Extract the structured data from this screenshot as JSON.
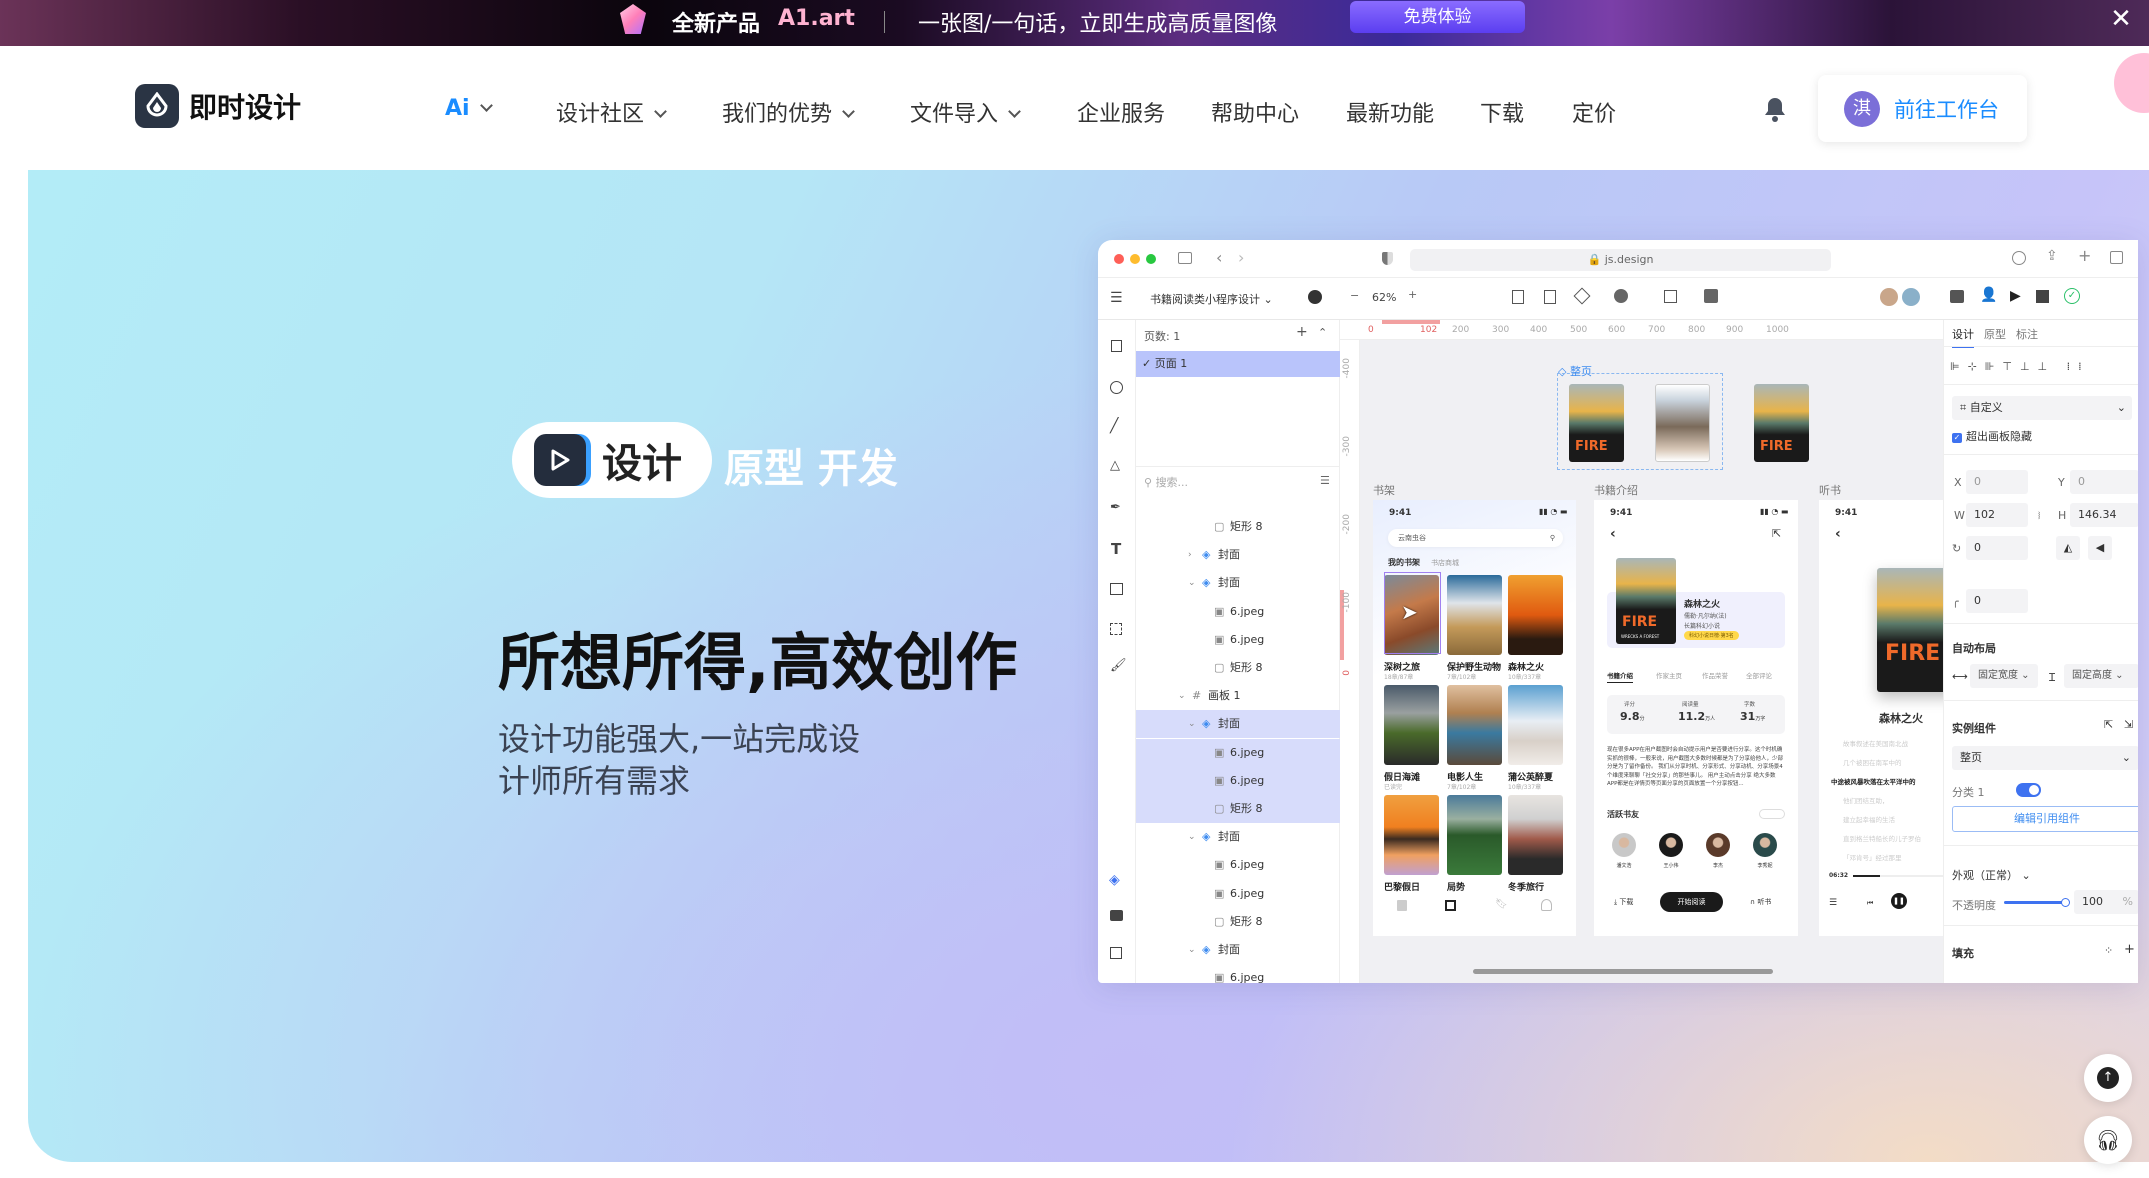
{
  "banner": {
    "product": "全新产品",
    "brand": "A1.art",
    "slogan": "一张图/一句话，立即生成高质量图像",
    "cta": "免费体验",
    "close_icon": "close-icon",
    "brand_color": "#ffb3d1"
  },
  "nav": {
    "logo": "即时设计",
    "items": [
      {
        "label": "Ai",
        "dropdown": true,
        "active": true
      },
      {
        "label": "设计社区",
        "dropdown": true
      },
      {
        "label": "我们的优势",
        "dropdown": true
      },
      {
        "label": "文件导入",
        "dropdown": true
      },
      {
        "label": "企业服务"
      },
      {
        "label": "帮助中心"
      },
      {
        "label": "最新功能"
      },
      {
        "label": "下载"
      },
      {
        "label": "定价"
      }
    ],
    "avatar_initial": "淇",
    "workspace_button": "前往工作台",
    "accent": "#1a8cff"
  },
  "hero": {
    "pill_label": "设计",
    "pill_rest": "原型 开发",
    "headline": "所想所得,高效创作",
    "sub_line1": "设计功能强大,一站完成设",
    "sub_line2": "计师所有需求"
  },
  "mock": {
    "url": "js.design",
    "file_name": "书籍阅读类小程序设计",
    "zoom": "62%",
    "pages_label": "页数: 1",
    "page1": "页面 1",
    "search_placeholder": "搜索...",
    "layers": [
      {
        "name": "矩形 8",
        "level": 2,
        "type": "rect"
      },
      {
        "name": "封面",
        "level": 1,
        "type": "comp",
        "arrow": "right"
      },
      {
        "name": "封面",
        "level": 1,
        "type": "comp",
        "arrow": "down"
      },
      {
        "name": "6.jpeg",
        "level": 2,
        "type": "img"
      },
      {
        "name": "6.jpeg",
        "level": 2,
        "type": "img"
      },
      {
        "name": "矩形 8",
        "level": 2,
        "type": "rect"
      },
      {
        "name": "画板 1",
        "level": 0,
        "type": "board",
        "arrow": "down"
      },
      {
        "name": "封面",
        "level": 1,
        "type": "comp",
        "arrow": "down",
        "selected": true
      },
      {
        "name": "6.jpeg",
        "level": 2,
        "type": "img",
        "selected": true
      },
      {
        "name": "6.jpeg",
        "level": 2,
        "type": "img",
        "selected": true
      },
      {
        "name": "矩形 8",
        "level": 2,
        "type": "rect",
        "selected": true
      },
      {
        "name": "封面",
        "level": 1,
        "type": "comp",
        "arrow": "down"
      },
      {
        "name": "6.jpeg",
        "level": 2,
        "type": "img"
      },
      {
        "name": "6.jpeg",
        "level": 2,
        "type": "img"
      },
      {
        "name": "矩形 8",
        "level": 2,
        "type": "rect"
      },
      {
        "name": "封面",
        "level": 1,
        "type": "comp",
        "arrow": "down"
      },
      {
        "name": "6.jpeg",
        "level": 2,
        "type": "img"
      }
    ],
    "ruler_x": [
      "0",
      "102",
      "200",
      "300",
      "400",
      "500",
      "600",
      "700",
      "800",
      "900",
      "1000"
    ],
    "ruler_y": [
      "-400",
      "-300",
      "-200",
      "-100",
      "0"
    ],
    "frame_label": "整页",
    "frames": [
      "书架",
      "书籍介绍",
      "听书"
    ],
    "shelf": {
      "time": "9:41",
      "search": "云南虫谷",
      "tab_active": "我的书架",
      "tab_other": "书店商城",
      "books": [
        {
          "title": "深树之旅",
          "sub": "18章/87章"
        },
        {
          "title": "保护野生动物",
          "sub": "7章/102章"
        },
        {
          "title": "森林之火",
          "sub": "10章/337章"
        },
        {
          "title": "假日海滩",
          "sub": "已读完"
        },
        {
          "title": "电影人生",
          "sub": "7章/102章"
        },
        {
          "title": "蒲公英醉夏",
          "sub": "10章/337章"
        },
        {
          "title": "巴黎假日",
          "sub": ""
        },
        {
          "title": "局势",
          "sub": ""
        },
        {
          "title": "冬季旅行",
          "sub": ""
        }
      ]
    },
    "intro": {
      "time": "9:41",
      "title": "森林之火",
      "author": "儒勒·凡尔纳(法)",
      "genre": "长篇科幻小说",
      "badge": "科幻小说日榜·第3名",
      "cover_text": "FIRE",
      "cover_sub": "WRECKS A FOREST",
      "tabs": [
        "书籍介绍",
        "作家主页",
        "作品荣誉",
        "全部评论"
      ],
      "stats": [
        {
          "label": "评分",
          "value": "9.8",
          "unit": "分"
        },
        {
          "label": "阅读量",
          "value": "11.2",
          "unit": "万人"
        },
        {
          "label": "字数",
          "value": "31",
          "unit": "万字"
        }
      ],
      "desc": "现在很多APP在用户截图时会自动提示用户是否要进行分享。这个时机确实抓的很棒，一般来说，用户截图大多数时候都是为了分享给他人，少部分是为了留作备份。 我们从分享时机、分享形式、分享动机、分享场景4个维度来聊聊「社交分享」的那些事儿。 用户主动点击分享 绝大多数APP都是在详情页等页面分享的页面放置一个分享按钮...",
      "friends_title": "活跃书友",
      "friends": [
        "潘文浩",
        "王小伟",
        "李杰",
        "李秀妮"
      ],
      "download": "下载",
      "read": "开始阅读",
      "listen": "听书"
    },
    "listen": {
      "time": "9:41",
      "title": "森林之火",
      "lines": [
        "故事叙述在美国南北战",
        "几个被困在南军中的",
        "中途被风暴吹落在太平洋中的",
        "他们团结互助，",
        "建立起幸福的生活",
        "直到格兰特船长的儿子罗伯",
        "「邓肯号」经过那里"
      ],
      "current_line": 2,
      "elapsed": "06:32",
      "progress": 0.3
    },
    "panel": {
      "tabs": [
        "设计",
        "原型",
        "标注"
      ],
      "frame_preset": "自定义",
      "clip_label": "超出画板隐藏",
      "clip": true,
      "x": "0",
      "y": "0",
      "w": "102",
      "h": "146.34",
      "rotation": "0",
      "radius": "0",
      "auto_layout": "自动布局",
      "fixed_w": "固定宽度",
      "fixed_h": "固定高度",
      "instance": "实例组件",
      "instance_value": "整页",
      "variant_label": "分类 1",
      "variant_on": true,
      "edit_component": "编辑引用组件",
      "appearance": "外观（正常）",
      "opacity_label": "不透明度",
      "opacity": "100",
      "opacity_unit": "%",
      "fill": "填充"
    }
  }
}
